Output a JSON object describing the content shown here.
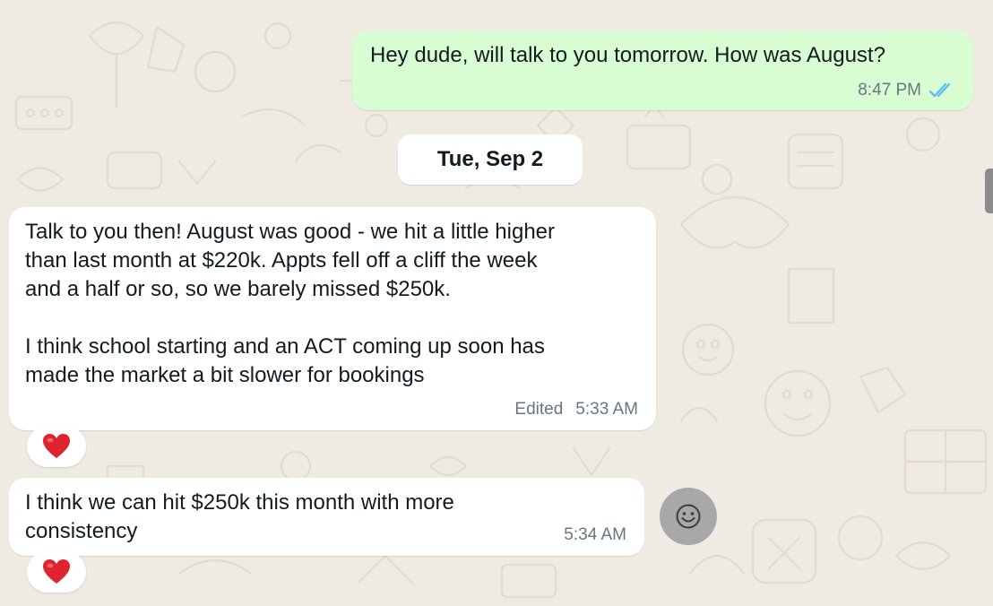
{
  "colors": {
    "background": "#efeae2",
    "outgoing_bubble": "#d9fdd3",
    "incoming_bubble": "#ffffff",
    "read_ticks": "#53bdeb",
    "timestamp": "#667781",
    "reaction_heart": "#e0242f"
  },
  "messages": [
    {
      "direction": "outgoing",
      "text": "Hey dude, will talk to you tomorrow. How was August?",
      "time": "8:47 PM",
      "status_icon": "double-check-read-icon"
    },
    {
      "direction": "incoming",
      "text": "Talk to you then! August was good - we hit a little higher\nthan last month at $220k. Appts fell off a cliff the week\nand a half or so, so we barely missed $250k.\n\nI think school starting and an ACT coming up soon has\nmade the market a bit slower for bookings",
      "edited_label": "Edited",
      "time": "5:33 AM",
      "reaction": "heart-emoji"
    },
    {
      "direction": "incoming",
      "text": "I think we can hit $250k this month with more\nconsistency",
      "time": "5:34 AM",
      "reaction": "heart-emoji"
    }
  ],
  "date_separator": "Tue, Sep 2",
  "emoji_button_icon": "smiley-icon"
}
